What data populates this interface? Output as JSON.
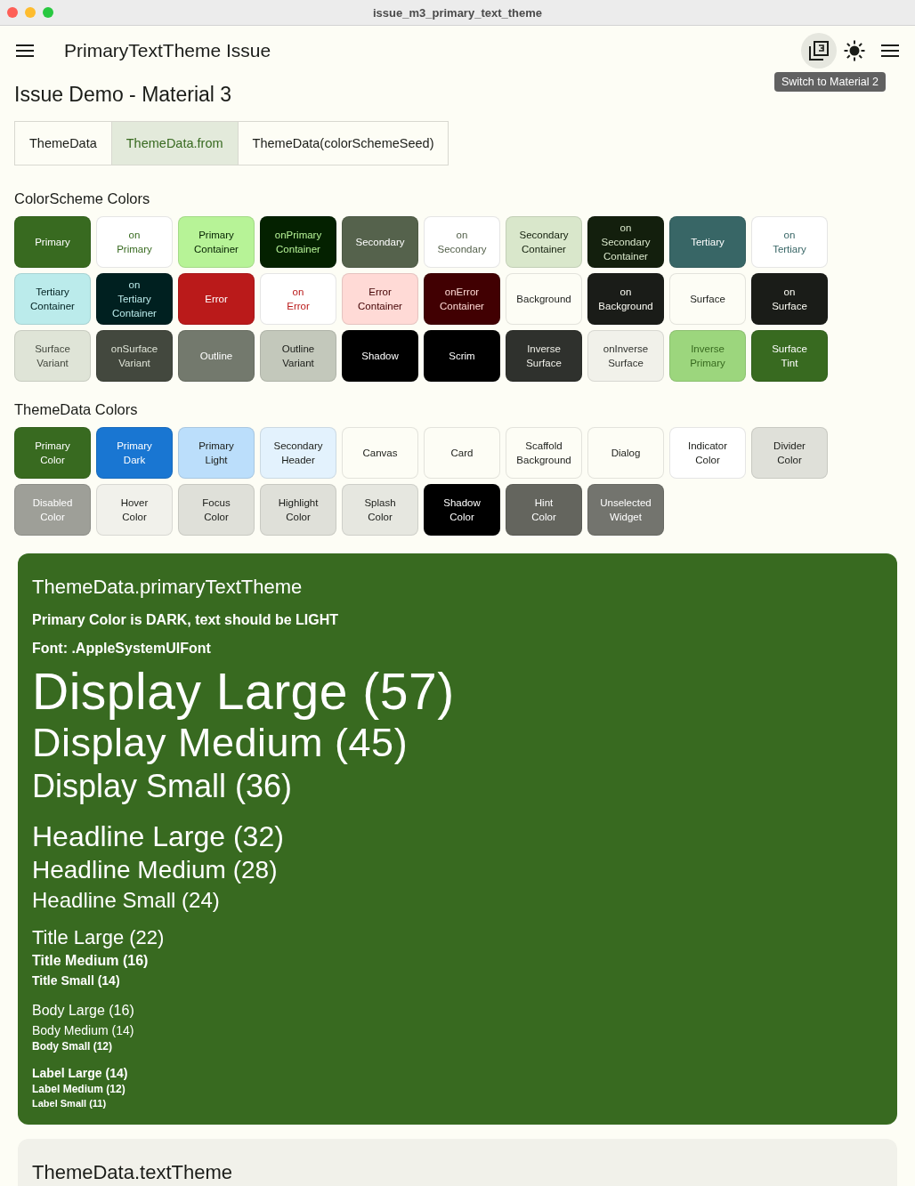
{
  "window": {
    "title": "issue_m3_primary_text_theme"
  },
  "app_bar": {
    "title": "PrimaryTextTheme Issue",
    "tooltip": "Switch to Material 2",
    "material3_on": true
  },
  "heading": "Issue Demo - Material 3",
  "tabs": [
    {
      "label": "ThemeData",
      "selected": false
    },
    {
      "label": "ThemeData.from",
      "selected": true
    },
    {
      "label": "ThemeData(colorSchemeSeed)",
      "selected": false
    }
  ],
  "sections": [
    {
      "title": "ColorScheme Colors",
      "swatches": [
        {
          "color": "#386a20",
          "label": {
            "text": "Primary",
            "color": "#ffffff"
          }
        },
        {
          "color": "#ffffff",
          "label": {
            "text": "on\nPrimary",
            "color": "#386a20"
          }
        },
        {
          "color": "#b7f397",
          "label": {
            "text": "Primary\nContainer",
            "color": "#042100"
          }
        },
        {
          "color": "#042100",
          "label": {
            "text": "onPrimary\nContainer",
            "color": "#b7f397"
          }
        },
        {
          "color": "#55624c",
          "label": {
            "text": "Secondary",
            "color": "#ffffff"
          }
        },
        {
          "color": "#ffffff",
          "label": {
            "text": "on\nSecondary",
            "color": "#55624c"
          }
        },
        {
          "color": "#d9e7cb",
          "label": {
            "text": "Secondary\nContainer",
            "color": "#131f0d"
          }
        },
        {
          "color": "#131f0d",
          "label": {
            "text": "on\nSecondary\nContainer",
            "color": "#d9e7cb"
          }
        },
        {
          "color": "#386666",
          "label": {
            "text": "Tertiary",
            "color": "#ffffff"
          }
        },
        {
          "color": "#ffffff",
          "label": {
            "text": "on\nTertiary",
            "color": "#386666"
          }
        },
        {
          "color": "#bbebeb",
          "label": {
            "text": "Tertiary\nContainer",
            "color": "#002020"
          }
        },
        {
          "color": "#002020",
          "label": {
            "text": "on\nTertiary\nContainer",
            "color": "#bbebeb"
          }
        },
        {
          "color": "#ba1a1a",
          "label": {
            "text": "Error",
            "color": "#ffffff"
          }
        },
        {
          "color": "#ffffff",
          "label": {
            "text": "on\nError",
            "color": "#ba1a1a"
          }
        },
        {
          "color": "#ffdad6",
          "label": {
            "text": "Error\nContainer",
            "color": "#410002"
          }
        },
        {
          "color": "#410002",
          "label": {
            "text": "onError\nContainer",
            "color": "#ffdad6"
          }
        },
        {
          "color": "#fdfdf5",
          "label": {
            "text": "Background",
            "color": "#1a1c18"
          }
        },
        {
          "color": "#1a1c18",
          "label": {
            "text": "on\nBackground",
            "color": "#fdfdf5"
          }
        },
        {
          "color": "#fdfdf5",
          "label": {
            "text": "Surface",
            "color": "#1a1c18"
          }
        },
        {
          "color": "#1a1c18",
          "label": {
            "text": "on\nSurface",
            "color": "#fdfdf5"
          }
        },
        {
          "color": "#dfe4d7",
          "label": {
            "text": "Surface\nVariant",
            "color": "#43483e"
          }
        },
        {
          "color": "#43483e",
          "label": {
            "text": "onSurface\nVariant",
            "color": "#dfe4d7"
          }
        },
        {
          "color": "#73796d",
          "label": {
            "text": "Outline",
            "color": "#ffffff"
          }
        },
        {
          "color": "#c3c8bb",
          "label": {
            "text": "Outline\nVariant",
            "color": "#1a1c18"
          }
        },
        {
          "color": "#000000",
          "label": {
            "text": "Shadow",
            "color": "#ffffff"
          }
        },
        {
          "color": "#000000",
          "label": {
            "text": "Scrim",
            "color": "#ffffff"
          }
        },
        {
          "color": "#2f312d",
          "label": {
            "text": "Inverse\nSurface",
            "color": "#f1f1ea"
          }
        },
        {
          "color": "#f1f1ea",
          "label": {
            "text": "onInverse\nSurface",
            "color": "#2f312d"
          }
        },
        {
          "color": "#9cd67d",
          "label": {
            "text": "Inverse\nPrimary",
            "color": "#386a20"
          }
        },
        {
          "color": "#386a20",
          "label": {
            "text": "Surface\nTint",
            "color": "#ffffff"
          }
        }
      ]
    },
    {
      "title": "ThemeData Colors",
      "swatches": [
        {
          "color": "#386a20",
          "label": {
            "text": "Primary\nColor",
            "color": "#ffffff"
          }
        },
        {
          "color": "#1976d2",
          "label": {
            "text": "Primary\nDark",
            "color": "#ffffff"
          }
        },
        {
          "color": "#bbdefb",
          "label": {
            "text": "Primary\nLight",
            "color": "#1a1c18"
          }
        },
        {
          "color": "#e3f2fd",
          "label": {
            "text": "Secondary\nHeader",
            "color": "#1a1c18"
          }
        },
        {
          "color": "#fdfdf5",
          "label": {
            "text": "Canvas",
            "color": "#1a1c18"
          }
        },
        {
          "color": "#fdfdf5",
          "label": {
            "text": "Card",
            "color": "#1a1c18"
          }
        },
        {
          "color": "#fdfdf5",
          "label": {
            "text": "Scaffold\nBackground",
            "color": "#1a1c18"
          }
        },
        {
          "color": "#fdfdf5",
          "label": {
            "text": "Dialog",
            "color": "#1a1c18"
          }
        },
        {
          "color": "#ffffff",
          "label": {
            "text": "Indicator\nColor",
            "color": "#1a1c18"
          }
        },
        {
          "color": "#dfe0d9",
          "label": {
            "text": "Divider\nColor",
            "color": "#1a1c18"
          }
        },
        {
          "color": "#9e9f98",
          "label": {
            "text": "Disabled\nColor",
            "color": "#ffffff"
          }
        },
        {
          "color": "#f1f1eb",
          "label": {
            "text": "Hover\nColor",
            "color": "#1a1c18"
          }
        },
        {
          "color": "#dfe0d9",
          "label": {
            "text": "Focus\nColor",
            "color": "#1a1c18"
          }
        },
        {
          "color": "#dfe0d9",
          "label": {
            "text": "Highlight\nColor",
            "color": "#1a1c18"
          }
        },
        {
          "color": "#e6e7e0",
          "label": {
            "text": "Splash\nColor",
            "color": "#1a1c18"
          }
        },
        {
          "color": "#000000",
          "label": {
            "text": "Shadow\nColor",
            "color": "#ffffff"
          }
        },
        {
          "color": "#64655e",
          "label": {
            "text": "Hint\nColor",
            "color": "#ffffff"
          }
        },
        {
          "color": "#73746e",
          "label": {
            "text": "Unselected\nWidget",
            "color": "#ffffff"
          }
        }
      ]
    }
  ],
  "text_cards": [
    {
      "kind": "primary",
      "title": "ThemeData.primaryTextTheme",
      "lines": [
        {
          "kind": "note",
          "text": "Primary Color is DARK, text should be LIGHT"
        },
        {
          "kind": "note",
          "text": "Font: .AppleSystemUIFont"
        },
        {
          "kind": "displayLarge",
          "text": "Display Large (57)"
        },
        {
          "kind": "displayMedium",
          "text": "Display Medium (45)"
        },
        {
          "kind": "displaySmall",
          "text": "Display Small (36)"
        },
        {
          "kind": "headlineLarge",
          "text": "Headline Large (32)"
        },
        {
          "kind": "headlineMedium",
          "text": "Headline Medium (28)"
        },
        {
          "kind": "headlineSmall",
          "text": "Headline Small (24)"
        },
        {
          "kind": "titleLarge",
          "text": "Title Large (22)"
        },
        {
          "kind": "titleMedium",
          "text": "Title Medium (16)"
        },
        {
          "kind": "titleSmall",
          "text": "Title Small (14)"
        },
        {
          "kind": "bodyLarge",
          "text": "Body Large (16)"
        },
        {
          "kind": "bodyMedium",
          "text": "Body Medium (14)"
        },
        {
          "kind": "bodySmall",
          "text": "Body Small (12)"
        },
        {
          "kind": "labelLarge",
          "text": "Label Large (14)"
        },
        {
          "kind": "labelMedium",
          "text": "Label Medium (12)"
        },
        {
          "kind": "labelSmall",
          "text": "Label Small (11)"
        }
      ]
    },
    {
      "kind": "surface",
      "title": "ThemeData.textTheme"
    }
  ]
}
